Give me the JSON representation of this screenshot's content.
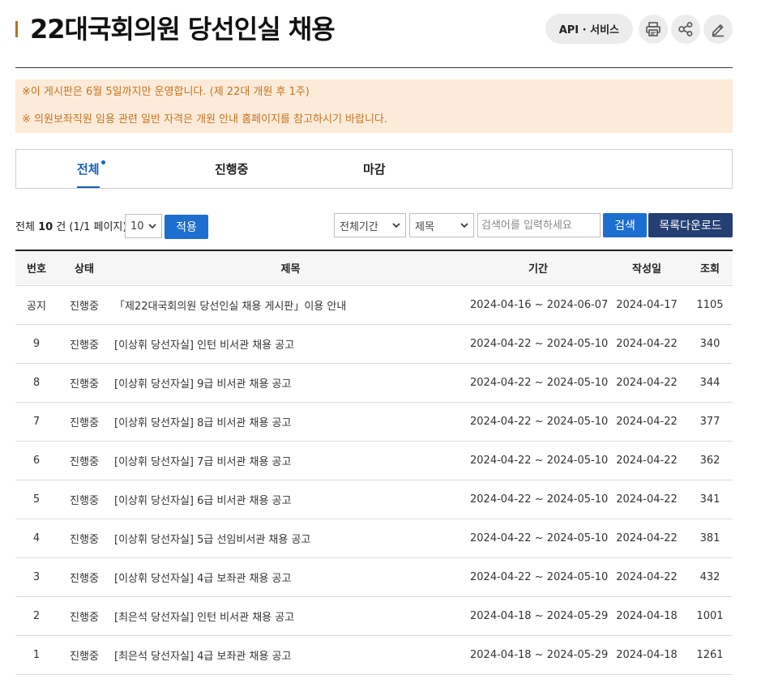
{
  "page": {
    "title": "22대국회의원 당선인실 채용",
    "api_service_label": "API · 서비스",
    "icons": [
      "print-icon",
      "share-icon",
      "edit-icon"
    ]
  },
  "notice": {
    "lines": [
      "※이 게시판은 6월 5일까지만 운영합니다. (제 22대 개원 후 1주)",
      "※ 의원보좌직원 임용 관련 일반 자격은 개원 안내 홈페이지를 참고하시기 바랍니다."
    ]
  },
  "tabs": [
    {
      "label": "전체",
      "active": true
    },
    {
      "label": "진행중",
      "active": false
    },
    {
      "label": "마감",
      "active": false
    }
  ],
  "toolbar": {
    "total_prefix": "전체",
    "total_count": "10",
    "total_suffix": "건 (1/1 페이지)",
    "page_size": "10",
    "apply_label": "적용",
    "period_select": "전체기간",
    "field_select": "제목",
    "search_placeholder": "검색어를 입력하세요",
    "search_label": "검색",
    "download_label": "목록다운로드"
  },
  "table": {
    "headers": {
      "no": "번호",
      "status": "상태",
      "title": "제목",
      "period": "기간",
      "date": "작성일",
      "views": "조회"
    },
    "rows": [
      {
        "no": "공지",
        "status": "진행중",
        "title": "「제22대국회의원 당선인실 채용 게시판」이용 안내",
        "period": "2024-04-16 ~ 2024-06-07",
        "date": "2024-04-17",
        "views": "1105"
      },
      {
        "no": "9",
        "status": "진행중",
        "title": "[이상휘 당선자실] 인턴 비서관 채용 공고",
        "period": "2024-04-22 ~ 2024-05-10",
        "date": "2024-04-22",
        "views": "340"
      },
      {
        "no": "8",
        "status": "진행중",
        "title": "[이상휘 당선자실] 9급 비서관 채용 공고",
        "period": "2024-04-22 ~ 2024-05-10",
        "date": "2024-04-22",
        "views": "344"
      },
      {
        "no": "7",
        "status": "진행중",
        "title": "[이상휘 당선자실] 8급 비서관 채용 공고",
        "period": "2024-04-22 ~ 2024-05-10",
        "date": "2024-04-22",
        "views": "377"
      },
      {
        "no": "6",
        "status": "진행중",
        "title": "[이상휘 당선자실] 7급 비서관 채용 공고",
        "period": "2024-04-22 ~ 2024-05-10",
        "date": "2024-04-22",
        "views": "362"
      },
      {
        "no": "5",
        "status": "진행중",
        "title": "[이상휘 당선자실] 6급 비서관 채용 공고",
        "period": "2024-04-22 ~ 2024-05-10",
        "date": "2024-04-22",
        "views": "341"
      },
      {
        "no": "4",
        "status": "진행중",
        "title": "[이상휘 당선자실] 5급 선임비서관 채용 공고",
        "period": "2024-04-22 ~ 2024-05-10",
        "date": "2024-04-22",
        "views": "381"
      },
      {
        "no": "3",
        "status": "진행중",
        "title": "[이상휘 당선자실] 4급 보좌관 채용 공고",
        "period": "2024-04-22 ~ 2024-05-10",
        "date": "2024-04-22",
        "views": "432"
      },
      {
        "no": "2",
        "status": "진행중",
        "title": "[최은석 당선자실] 인턴 비서관 채용 공고",
        "period": "2024-04-18 ~ 2024-05-29",
        "date": "2024-04-18",
        "views": "1001"
      },
      {
        "no": "1",
        "status": "진행중",
        "title": "[최은석 당선자실] 4급 보좌관 채용 공고",
        "period": "2024-04-18 ~ 2024-05-29",
        "date": "2024-04-18",
        "views": "1261"
      }
    ]
  },
  "colors": {
    "accent_blue": "#1c6ecf",
    "navy": "#253f72",
    "notice_bg": "#fcebd9",
    "notice_text": "#c57422",
    "title_bar": "#b0772a"
  }
}
